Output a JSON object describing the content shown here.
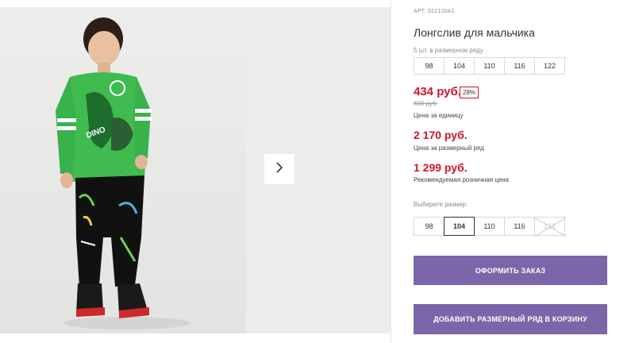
{
  "gallery": {
    "next_label": "›"
  },
  "product": {
    "art_label": "АРТ.",
    "art_value": "32212041",
    "title": "Лонгслив для мальчика",
    "pack_caption": "5 шт. в размерном ряду",
    "pack_sizes": [
      "98",
      "104",
      "110",
      "116",
      "122"
    ],
    "price_main": "434 руб.",
    "discount": "28%",
    "price_old": "600 руб.",
    "price_main_caption": "Цена за единицу",
    "price_pack": "2 170 руб.",
    "price_pack_caption": "Цена за размерный ряд",
    "price_retail": "1 299 руб.",
    "price_retail_caption": "Рекомендуемая розничная цена",
    "choose_size_label": "Выберите размер:",
    "select_sizes": [
      "98",
      "104",
      "110",
      "116",
      "122"
    ],
    "selected_size": "104",
    "unavailable_size": "122"
  },
  "actions": {
    "order_label": "ОФОРМИТЬ ЗАКАЗ",
    "add_pack_label": "ДОБАВИТЬ РАЗМЕРНЫЙ РЯД В КОРЗИНУ"
  },
  "colors": {
    "accent_button": "#7a66a8",
    "price_red": "#d3132a"
  }
}
